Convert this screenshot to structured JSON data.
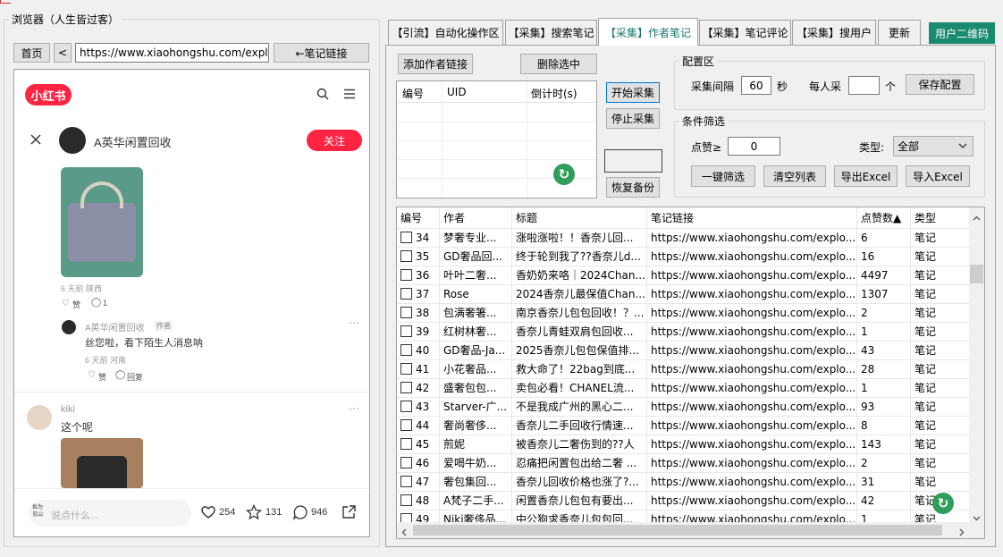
{
  "browser": {
    "group_title": "浏览器（人生皆过客）",
    "home_label": "首页",
    "back_label": "<",
    "url": "https://www.xiaohongshu.com/explor",
    "note_link_label": "←笔记链接"
  },
  "xhs": {
    "logo": "小红书",
    "author_name": "A英华闲置回收",
    "follow_label": "关注",
    "post_meta": "6 天前 陕西",
    "like_label": "赞",
    "comment_count": "1",
    "reply": {
      "author": "A英华闲置回收",
      "tag": "作者",
      "text": "丝您啦，看下陌生人消息呐",
      "meta": "6 天前 河南",
      "like_label": "赞",
      "reply_label": "回复"
    },
    "comment2": {
      "author": "kiki",
      "text": "这个呢"
    },
    "bottom": {
      "avatar_text": "拟为\n见山",
      "placeholder": "说点什么...",
      "likes": "254",
      "stars": "131",
      "comments": "946"
    }
  },
  "tabs": [
    {
      "label": "【引流】自动化操作区"
    },
    {
      "label": "【采集】搜索笔记"
    },
    {
      "label": "【采集】作者笔记"
    },
    {
      "label": "【采集】笔记评论"
    },
    {
      "label": "【采集】搜用户"
    },
    {
      "label": "更新"
    }
  ],
  "user_qr_label": "用户二维码",
  "author_panel": {
    "add_author_label": "添加作者链接",
    "delete_selected_label": "删除选中",
    "columns": [
      "编号",
      "UID",
      "倒计时(s)"
    ],
    "start_label": "开始采集",
    "stop_label": "停止采集",
    "restore_label": "恢复备份"
  },
  "config": {
    "title": "配置区",
    "interval_label": "采集间隔",
    "interval_value": "60",
    "seconds_label": "秒",
    "per_person_label": "每人采",
    "per_person_value": "",
    "unit_label": "个",
    "save_label": "保存配置"
  },
  "filter": {
    "title": "条件筛选",
    "likes_label": "点赞≥",
    "likes_value": "0",
    "type_label": "类型:",
    "type_value": "全部",
    "filter_label": "一键筛选",
    "clear_label": "清空列表",
    "export_label": "导出Excel",
    "import_label": "导入Excel"
  },
  "table": {
    "columns": [
      "编号",
      "作者",
      "标题",
      "笔记链接",
      "点赞数▲",
      "类型"
    ],
    "rows": [
      [
        "34",
        "梦奢专业...",
        "涨啦涨啦！！香奈儿回...",
        "https://www.xiaohongshu.com/explo...",
        "6",
        "笔记"
      ],
      [
        "35",
        "GD奢品回...",
        "终于轮到我了??香奈儿d...",
        "https://www.xiaohongshu.com/explo...",
        "16",
        "笔记"
      ],
      [
        "36",
        "叶叶二奢...",
        "香奶奶来咯｜2024Chan...",
        "https://www.xiaohongshu.com/explo...",
        "4497",
        "笔记"
      ],
      [
        "37",
        "Rose",
        "2024香奈儿最保值Chan...",
        "https://www.xiaohongshu.com/explo...",
        "1307",
        "笔记"
      ],
      [
        "38",
        "包满奢箸...",
        "南京香奈儿包包回收！？...",
        "https://www.xiaohongshu.com/explo...",
        "2",
        "笔记"
      ],
      [
        "39",
        "红树林奢...",
        "香奈儿青蛙双肩包回收...",
        "https://www.xiaohongshu.com/explo...",
        "1",
        "笔记"
      ],
      [
        "40",
        "GD奢品-Ja...",
        "2025香奈儿包包保值排...",
        "https://www.xiaohongshu.com/explo...",
        "43",
        "笔记"
      ],
      [
        "41",
        "小花奢品...",
        "救大命了！22bag到底...",
        "https://www.xiaohongshu.com/explo...",
        "28",
        "笔记"
      ],
      [
        "42",
        "盛奢包包...",
        "卖包必看！CHANEL流...",
        "https://www.xiaohongshu.com/explo...",
        "1",
        "笔记"
      ],
      [
        "43",
        "Starver-广...",
        "不是我成广州的黑心二...",
        "https://www.xiaohongshu.com/explo...",
        "93",
        "笔记"
      ],
      [
        "44",
        "奢尚奢侈...",
        "香奈儿二手回收行情速...",
        "https://www.xiaohongshu.com/explo...",
        "8",
        "笔记"
      ],
      [
        "45",
        "煎妮",
        "被香奈儿二奢伤到的??人",
        "https://www.xiaohongshu.com/explo...",
        "143",
        "笔记"
      ],
      [
        "46",
        "爱喝牛奶...",
        "忍痛把闲置包出给二奢 ...",
        "https://www.xiaohongshu.com/explo...",
        "2",
        "笔记"
      ],
      [
        "47",
        "奢包集回...",
        "香奈儿回收价格也涨了?...",
        "https://www.xiaohongshu.com/explo...",
        "31",
        "笔记"
      ],
      [
        "48",
        "A梵子二手...",
        "闲置香奈儿包包有要出...",
        "https://www.xiaohongshu.com/explo...",
        "42",
        "笔记"
      ],
      [
        "49",
        "Niki奢侈品...",
        "中公狗求香奈儿包包回...",
        "https://www.xiaohongshu.com/explo...",
        "1",
        "笔记"
      ]
    ]
  },
  "colors": {
    "accent": "#1a7a6e",
    "xhs_red": "#ff2442",
    "refresh_green": "#2e9e5a"
  }
}
